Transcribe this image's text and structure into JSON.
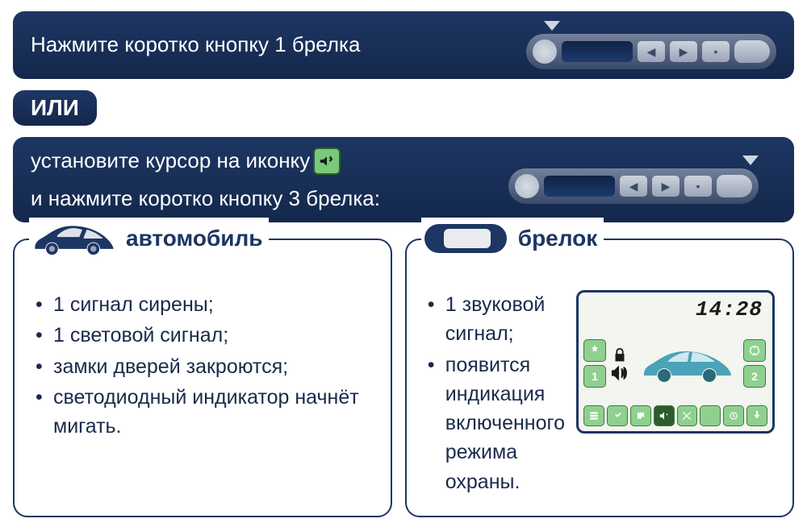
{
  "bar1": {
    "text": "Нажмите коротко кнопку 1 брелка"
  },
  "or_label": "ИЛИ",
  "bar2": {
    "line1_a": "установите курсор  на  иконку",
    "line2": "и нажмите коротко кнопку 3 брелка:"
  },
  "car_card": {
    "title": "автомобиль",
    "items": [
      "1 сигнал сирены;",
      "1 световой сигнал;",
      "замки дверей закроются;",
      "светодиодный индикатор начнёт мигать."
    ]
  },
  "fob_card": {
    "title": "брелок",
    "items": [
      "1 звуковой сигнал;",
      "появится индикация включенного режима охраны."
    ],
    "lcd_time": "14:28"
  }
}
